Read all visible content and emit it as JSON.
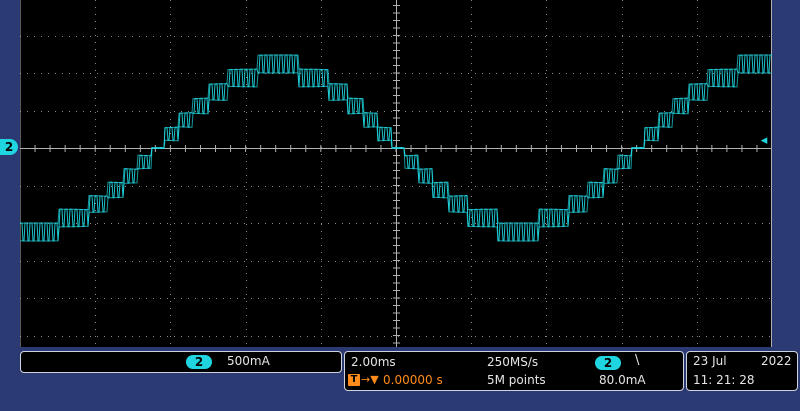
{
  "channel": {
    "number": "2",
    "scale": "500mA",
    "color": "#1fd6e0"
  },
  "trigger": {
    "level_arrow_icon": "left-arrow-icon",
    "position": "0.00000 s",
    "slope_symbol": "\\",
    "source": "2",
    "level": "80.0mA",
    "marker_glyphs": "→▼"
  },
  "timebase": {
    "scale": "2.00ms",
    "sample_rate": "250MS/s",
    "record_length": "5M points"
  },
  "datetime": {
    "date_day_month": "23 Jul",
    "year": "2022",
    "time": "11: 21: 28"
  },
  "colors": {
    "background": "#2b3a72",
    "screen": "#000000",
    "trace": "#1fd6e0",
    "trigger": "#ff8c1a",
    "grid": "#8a8a8a"
  },
  "waveform": {
    "description_type": "stepped sine with ripple",
    "cycles_visible": 1.6
  }
}
